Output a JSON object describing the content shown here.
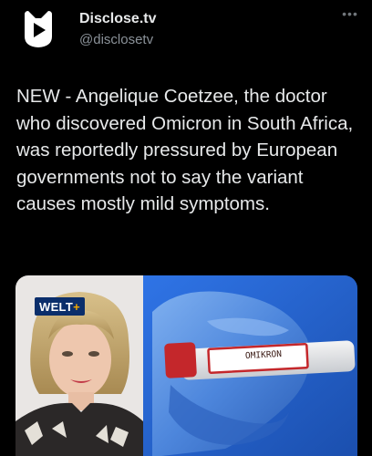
{
  "account": {
    "name": "Disclose.tv",
    "handle": "@disclosetv",
    "avatar_icon": "disclose-play-logo-icon"
  },
  "more_icon": "more-horizontal-icon",
  "more_glyph": "•••",
  "tweet": {
    "text": "NEW - Angelique Coetzee, the doctor who discovered Omicron in South Africa, was reportedly pressured by European governments not to say the variant causes mostly mild symptoms."
  },
  "media": {
    "badge_text": "WELT",
    "badge_plus": "+",
    "tube_label": "OMIKRON"
  },
  "colors": {
    "background": "#000000",
    "text": "#e7e9ea",
    "secondary_text": "#8b9299",
    "welt_blue": "#0b2e6b",
    "welt_accent": "#f2a900",
    "glove_blue": "#3b73d6",
    "tube_cap_red": "#c4272b"
  }
}
